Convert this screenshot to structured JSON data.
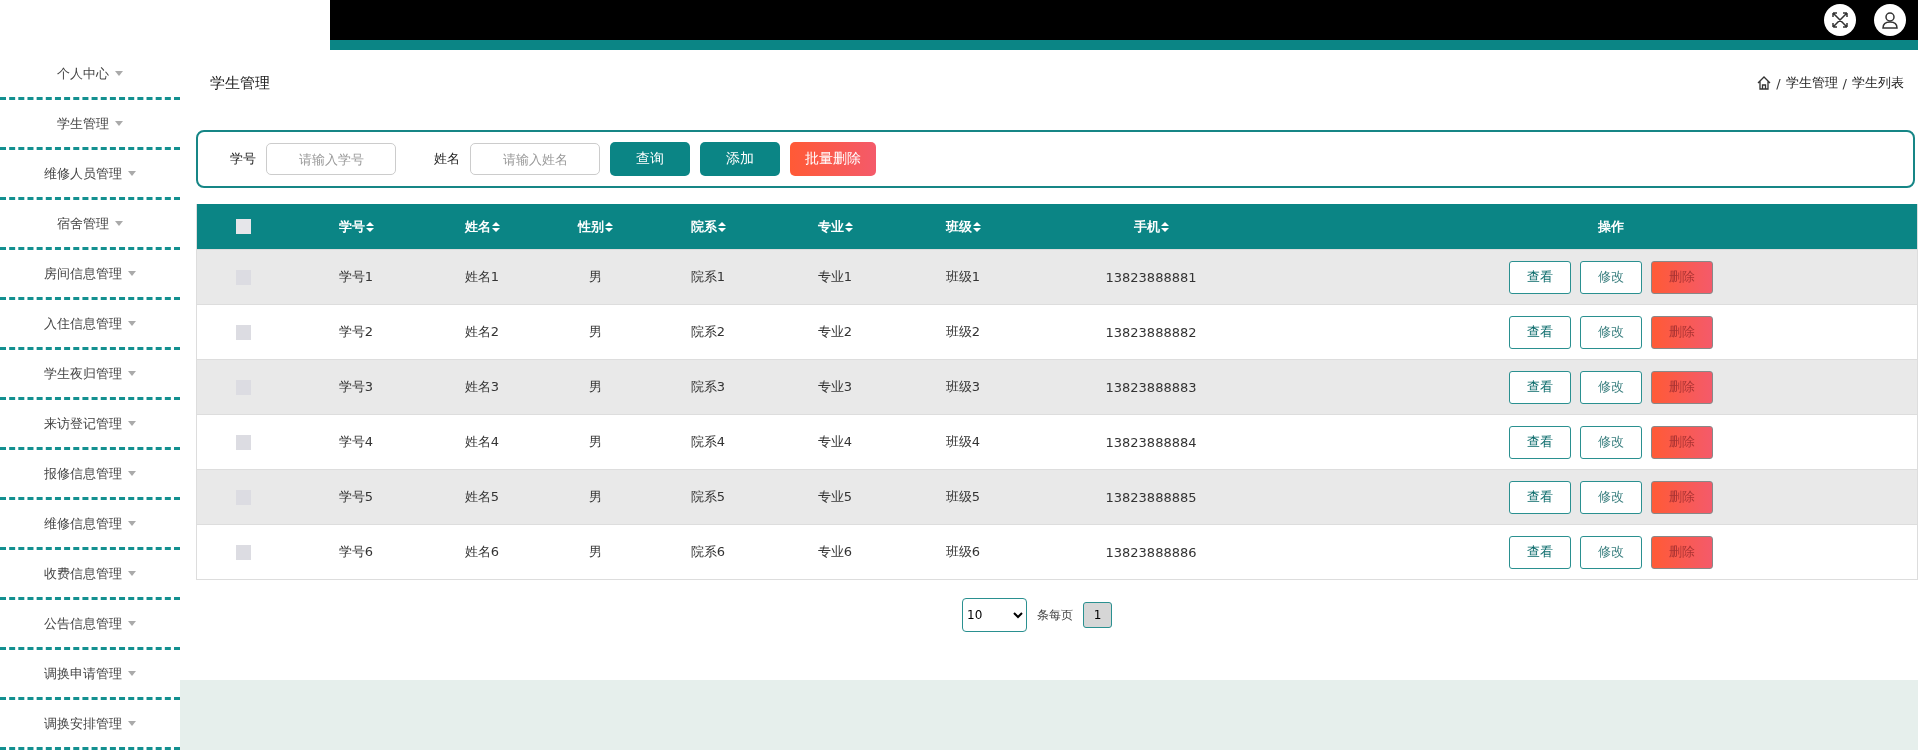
{
  "sidebar": {
    "items": [
      {
        "label": "个人中心"
      },
      {
        "label": "学生管理"
      },
      {
        "label": "维修人员管理"
      },
      {
        "label": "宿舍管理"
      },
      {
        "label": "房间信息管理"
      },
      {
        "label": "入住信息管理"
      },
      {
        "label": "学生夜归管理"
      },
      {
        "label": "来访登记管理"
      },
      {
        "label": "报修信息管理"
      },
      {
        "label": "维修信息管理"
      },
      {
        "label": "收费信息管理"
      },
      {
        "label": "公告信息管理"
      },
      {
        "label": "调换申请管理"
      },
      {
        "label": "调换安排管理"
      }
    ]
  },
  "page_title": "学生管理",
  "breadcrumb": {
    "separator": "/",
    "items": [
      "学生管理",
      "学生列表"
    ]
  },
  "search": {
    "fields": [
      {
        "label": "学号",
        "placeholder": "请输入学号"
      },
      {
        "label": "姓名",
        "placeholder": "请输入姓名"
      }
    ],
    "buttons": [
      {
        "label": "查询",
        "kind": "primary"
      },
      {
        "label": "添加",
        "kind": "primary"
      },
      {
        "label": "批量删除",
        "kind": "danger"
      }
    ]
  },
  "table": {
    "select_all": {
      "checked": false
    },
    "columns": [
      "学号",
      "姓名",
      "性别",
      "院系",
      "专业",
      "班级",
      "手机"
    ],
    "actions_column": "操作",
    "rows": [
      {
        "checked": false,
        "cells": [
          "学号1",
          "姓名1",
          "男",
          "院系1",
          "专业1",
          "班级1",
          "13823888881"
        ],
        "actions": [
          "查看",
          "修改",
          "删除"
        ]
      },
      {
        "checked": false,
        "cells": [
          "学号2",
          "姓名2",
          "男",
          "院系2",
          "专业2",
          "班级2",
          "13823888882"
        ],
        "actions": [
          "查看",
          "修改",
          "删除"
        ]
      },
      {
        "checked": false,
        "cells": [
          "学号3",
          "姓名3",
          "男",
          "院系3",
          "专业3",
          "班级3",
          "13823888883"
        ],
        "actions": [
          "查看",
          "修改",
          "删除"
        ]
      },
      {
        "checked": false,
        "cells": [
          "学号4",
          "姓名4",
          "男",
          "院系4",
          "专业4",
          "班级4",
          "13823888884"
        ],
        "actions": [
          "查看",
          "修改",
          "删除"
        ]
      },
      {
        "checked": false,
        "cells": [
          "学号5",
          "姓名5",
          "男",
          "院系5",
          "专业5",
          "班级5",
          "13823888885"
        ],
        "actions": [
          "查看",
          "修改",
          "删除"
        ]
      },
      {
        "checked": false,
        "cells": [
          "学号6",
          "姓名6",
          "男",
          "院系6",
          "专业6",
          "班级6",
          "13823888886"
        ],
        "actions": [
          "查看",
          "修改",
          "删除"
        ]
      }
    ]
  },
  "pagination": {
    "page_size": "10",
    "per_page_label": "条每页",
    "pages": [
      {
        "label": "1",
        "selected": true
      }
    ]
  }
}
